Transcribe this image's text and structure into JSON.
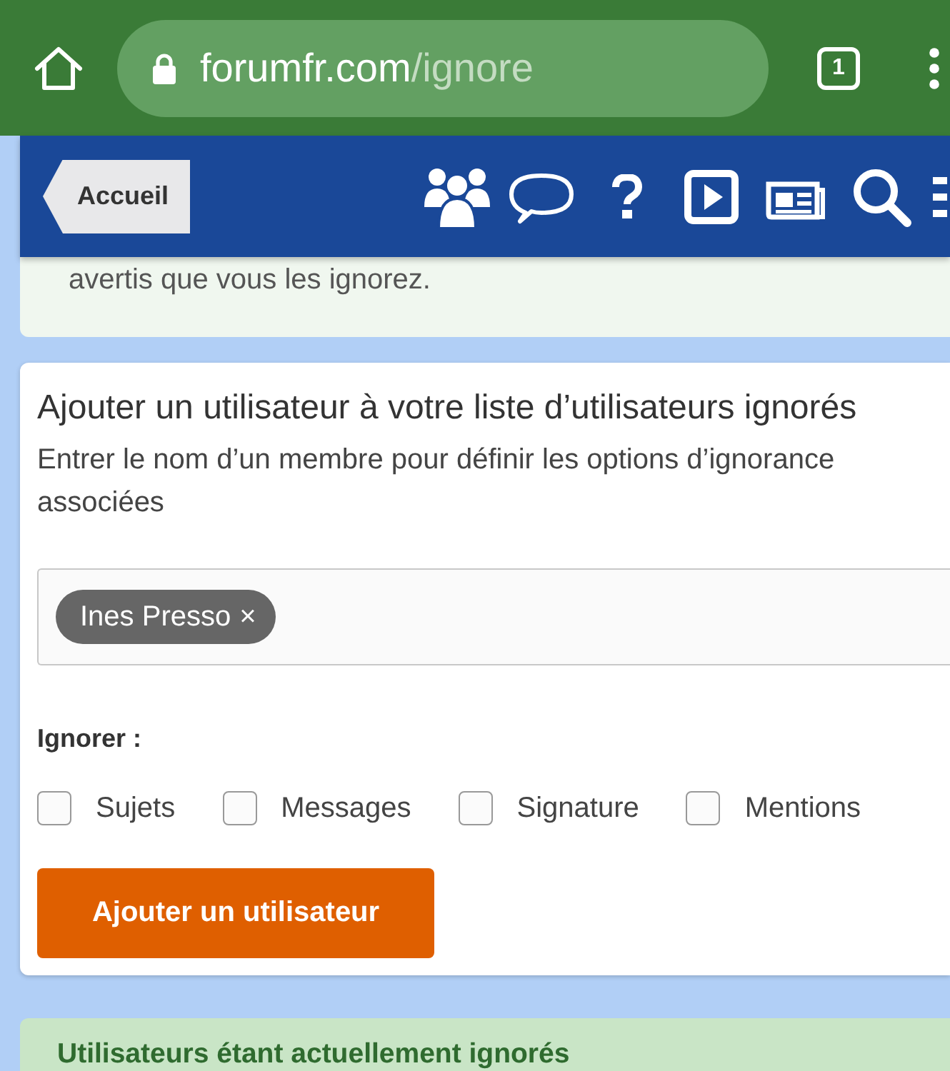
{
  "browser": {
    "url_host": "forumfr.com",
    "url_path": "/ignore",
    "tab_count": "1"
  },
  "nav": {
    "home_tab": "Accueil"
  },
  "notice": {
    "text": "avertis que vous les ignorez."
  },
  "add_form": {
    "title": "Ajouter un utilisateur à votre liste d’utilisateurs ignorés",
    "description": "Entrer le nom d’un membre pour définir les options d’ignorance associées",
    "tokens": [
      {
        "label": "Ines Presso",
        "remove": "×"
      }
    ],
    "ignore_label": "Ignorer :",
    "options": [
      {
        "label": "Sujets",
        "checked": false
      },
      {
        "label": "Messages",
        "checked": false
      },
      {
        "label": "Signature",
        "checked": false
      },
      {
        "label": "Mentions",
        "checked": false
      }
    ],
    "submit": "Ajouter un utilisateur"
  },
  "ignored_list": {
    "title": "Utilisateurs étant actuellement ignorés"
  }
}
